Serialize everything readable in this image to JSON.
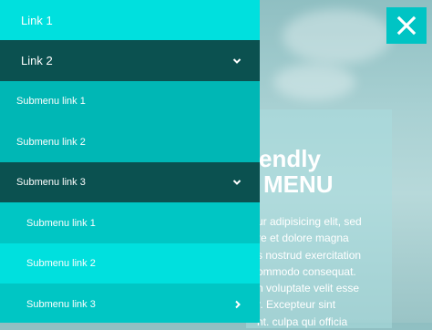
{
  "menu": {
    "items": [
      {
        "label": "Link 1",
        "color": "#00e0de",
        "height": 44,
        "chevron": "none"
      },
      {
        "label": "Link 2",
        "color": "#0b5150",
        "height": 45,
        "chevron": "down"
      },
      {
        "label": "Submenu link 1",
        "color": "#00b7b5",
        "height": 44,
        "chevron": "none"
      },
      {
        "label": "Submenu link 2",
        "color": "#00b7b5",
        "height": 45,
        "chevron": "none"
      },
      {
        "label": "Submenu link 3",
        "color": "#0b5150",
        "height": 44,
        "chevron": "down"
      },
      {
        "label": "Submenu link 1",
        "color": "#00c6c4",
        "height": 45,
        "chevron": "none"
      },
      {
        "label": "Submenu link 2",
        "color": "#00e0de",
        "height": 44,
        "chevron": "none"
      },
      {
        "label": "Submenu link 3",
        "color": "#00c6c4",
        "height": 45,
        "chevron": "right"
      }
    ]
  },
  "hero": {
    "title_line1": "endly",
    "title_line2": "MENU",
    "text_lines": [
      "ur adipisicing elit, sed",
      "re et dolore magna",
      "s nostrud exercitation",
      "ommodo consequat.",
      "n voluptate velit esse",
      "r. Excepteur sint",
      "nt. culpa qui officia"
    ]
  },
  "close_button": {
    "icon": "close-icon",
    "color": "#00c4c4"
  }
}
